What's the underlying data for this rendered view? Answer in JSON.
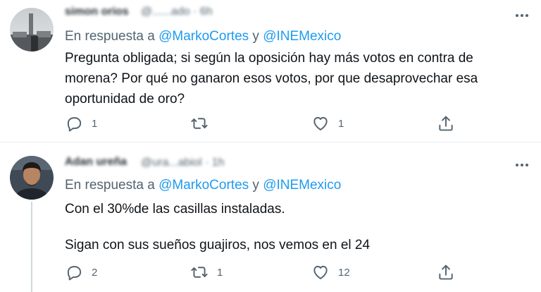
{
  "tweets": [
    {
      "author_name": "simon orios",
      "handle_time": "@......ado · 6h",
      "reply_prefix": "En respuesta a",
      "mention_1": "@MarkoCortes",
      "reply_conj": "y",
      "mention_2": "@INEMexico",
      "body_lines": [
        "Pregunta obligada; si según la oposición hay más votos en contra de",
        "morena? Por qué no ganaron esos votos, por que desaprovechar esa",
        "oportunidad de oro?"
      ],
      "reply_count": "1",
      "retweet_count": "",
      "like_count": "1"
    },
    {
      "author_name": "Adan ureña",
      "handle_time": "@ura...abiol · 1h",
      "reply_prefix": "En respuesta a",
      "mention_1": "@MarkoCortes",
      "reply_conj": "y",
      "mention_2": "@INEMexico",
      "body_lines": [
        "Con el 30%de las casillas instaladas.",
        "",
        "Sigan con sus sueños guajiros, nos vemos en el 24"
      ],
      "reply_count": "2",
      "retweet_count": "1",
      "like_count": "12"
    }
  ],
  "icons": {
    "more": "more-icon",
    "reply": "reply-icon",
    "retweet": "retweet-icon",
    "like": "heart-icon",
    "share": "share-icon"
  },
  "colors": {
    "accent": "#1d9bf0",
    "secondary_text": "#536471",
    "primary_text": "#0f1419",
    "divider": "#e6ecf0"
  }
}
